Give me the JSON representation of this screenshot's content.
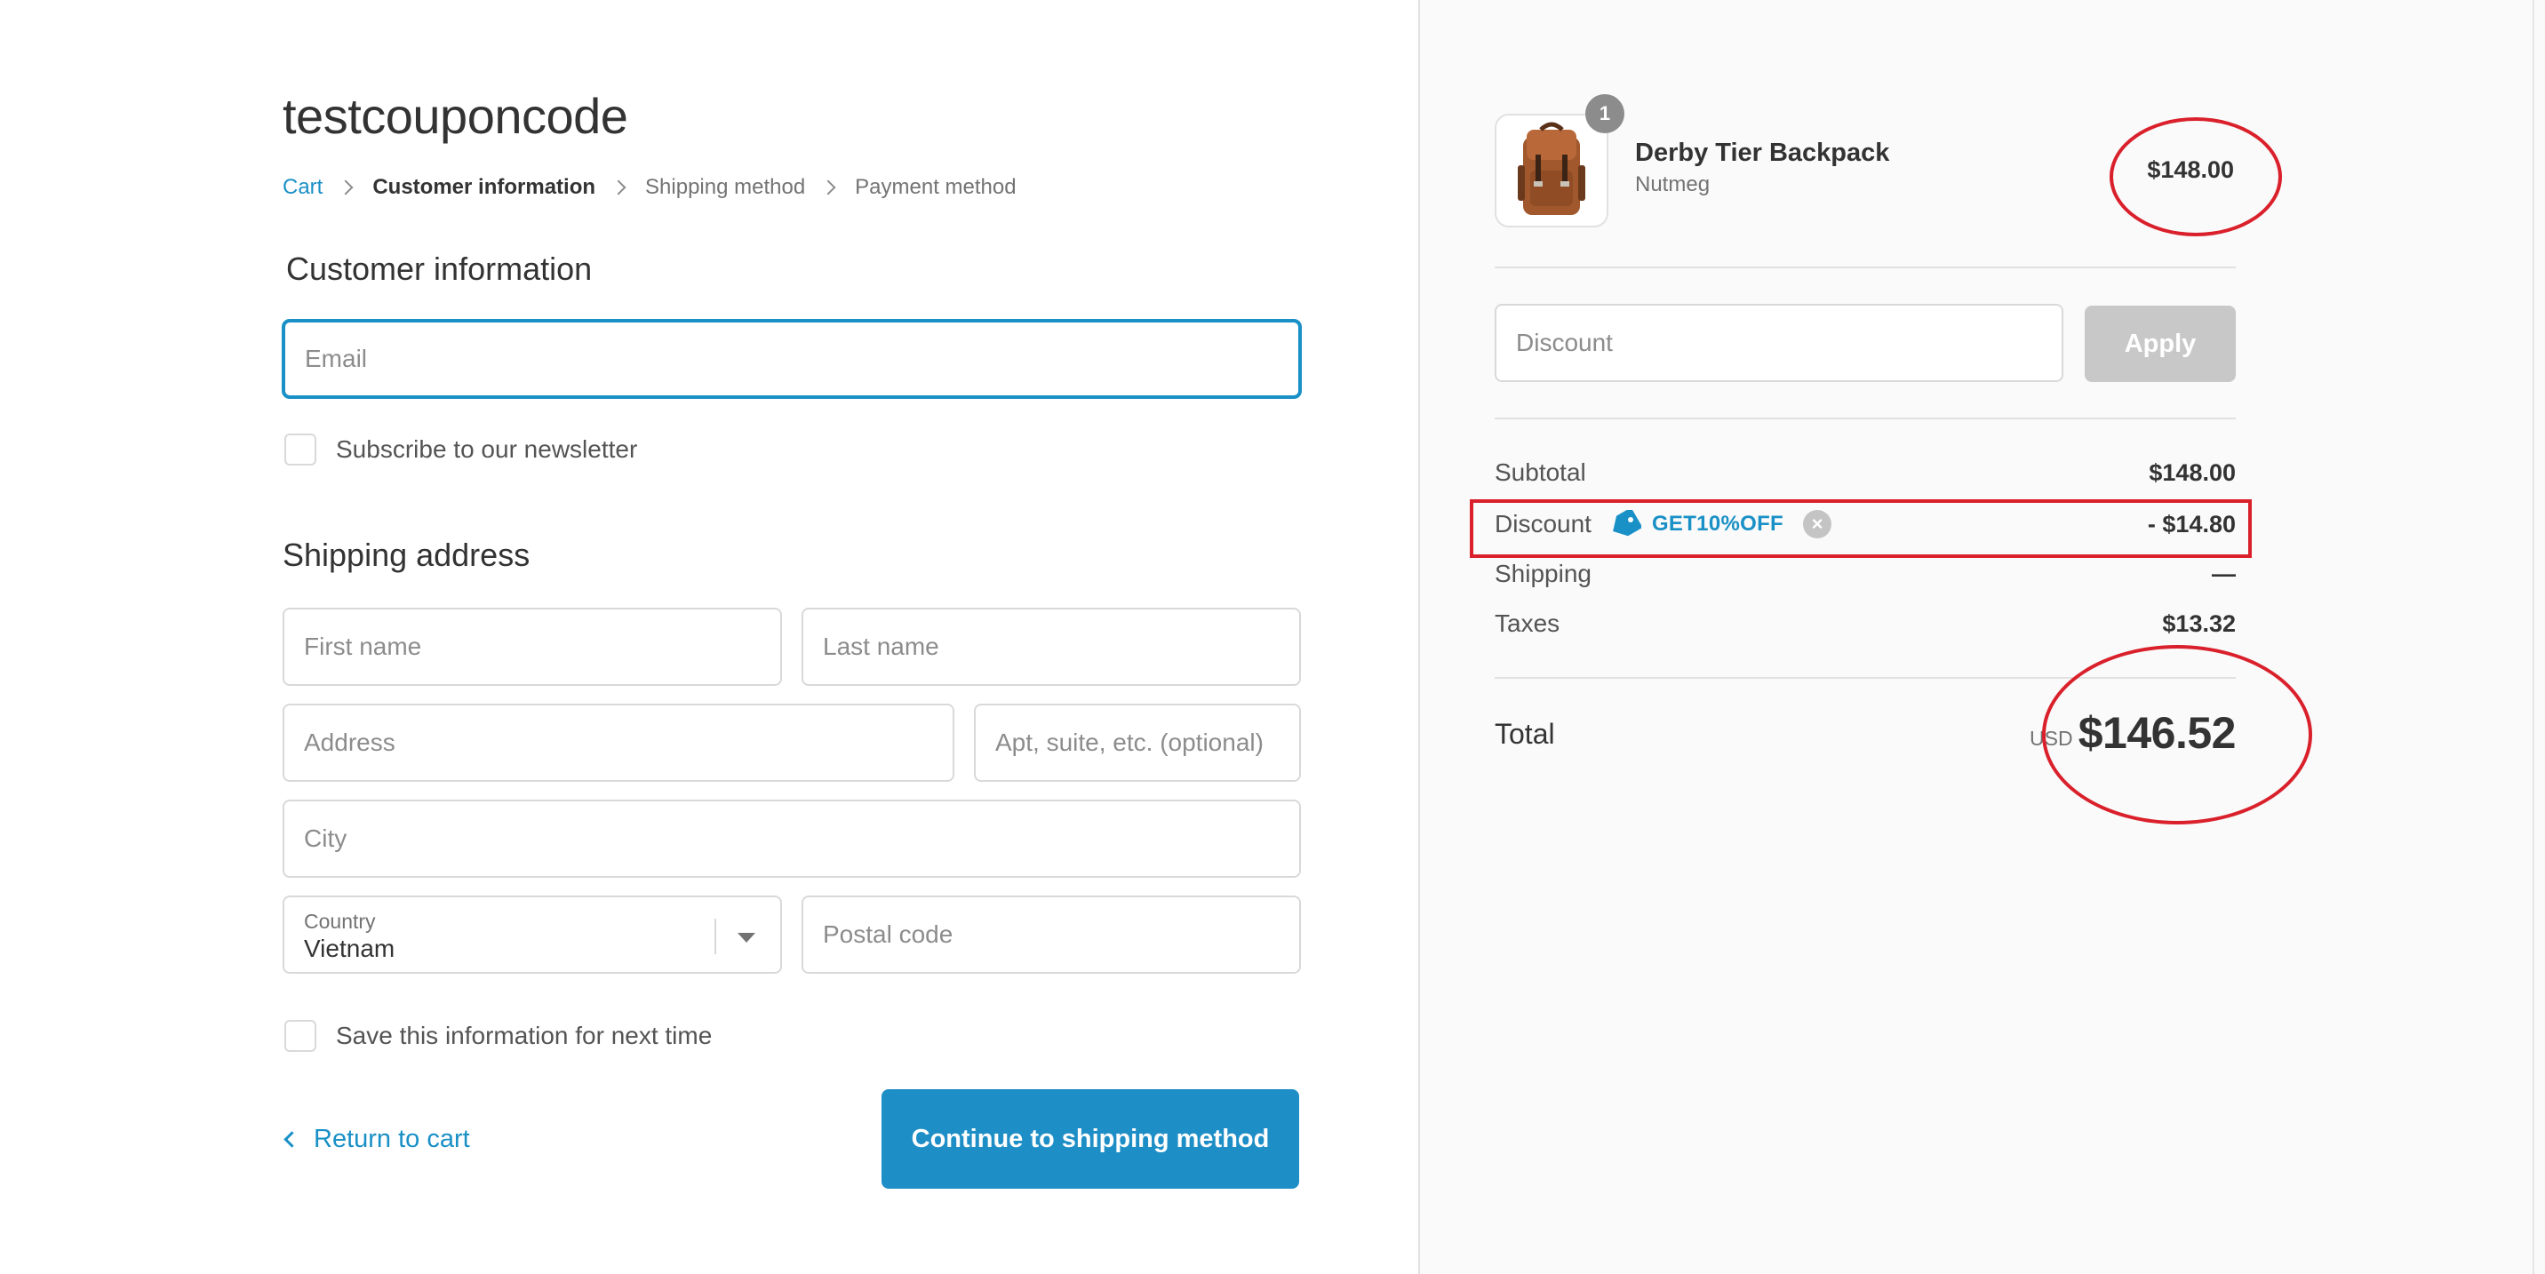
{
  "store": {
    "title": "testcouponcode"
  },
  "breadcrumb": {
    "cart": "Cart",
    "customer_information": "Customer information",
    "shipping_method": "Shipping method",
    "payment_method": "Payment method"
  },
  "customer_section": {
    "title": "Customer information",
    "email_placeholder": "Email",
    "email_value": "",
    "newsletter_label": "Subscribe to our newsletter"
  },
  "shipping_section": {
    "title": "Shipping address",
    "first_name_placeholder": "First name",
    "last_name_placeholder": "Last name",
    "address_placeholder": "Address",
    "apt_placeholder": "Apt, suite, etc. (optional)",
    "city_placeholder": "City",
    "country_label": "Country",
    "country_value": "Vietnam",
    "postal_placeholder": "Postal code",
    "save_info_label": "Save this information for next time"
  },
  "actions": {
    "return_label": "Return to cart",
    "continue_label": "Continue to shipping method"
  },
  "order": {
    "product": {
      "name": "Derby Tier Backpack",
      "variant": "Nutmeg",
      "price": "$148.00",
      "quantity": "1"
    },
    "discount_placeholder": "Discount",
    "apply_label": "Apply",
    "subtotal_label": "Subtotal",
    "subtotal_value": "$148.00",
    "discount_label": "Discount",
    "discount_code": "GET10%OFF",
    "discount_value": "- $14.80",
    "shipping_label": "Shipping",
    "shipping_value": "—",
    "taxes_label": "Taxes",
    "taxes_value": "$13.32",
    "total_label": "Total",
    "total_currency": "USD",
    "total_value": "$146.52"
  },
  "colors": {
    "accent": "#1990c6",
    "button": "#1e8ec6",
    "annotation": "#d9202b",
    "sidebar_bg": "#fafafa"
  },
  "icons": {
    "breadcrumb_separator": "chevron-right-icon",
    "back": "chevron-left-icon",
    "select": "caret-down-icon",
    "discount_tag": "tag-icon",
    "remove_discount": "close-circle-icon"
  }
}
